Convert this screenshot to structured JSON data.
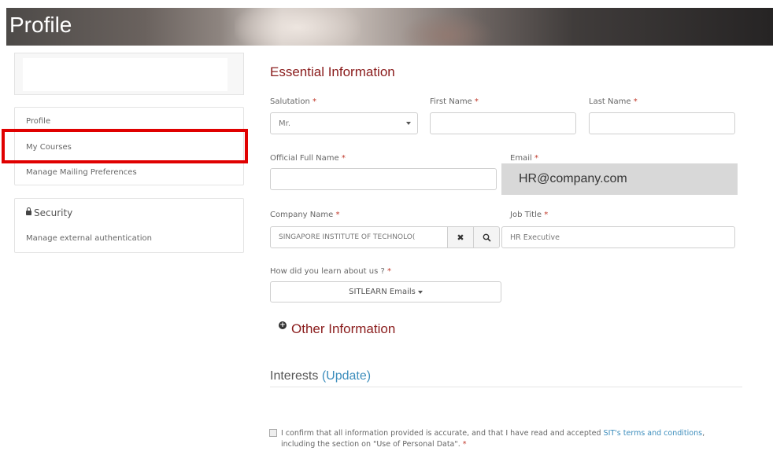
{
  "header": {
    "title": "Profile"
  },
  "sidebar": {
    "nav_items": [
      {
        "label": "Profile"
      },
      {
        "label": "My Courses"
      },
      {
        "label": "Manage Mailing Preferences"
      }
    ],
    "security": {
      "heading": "Security",
      "items": [
        {
          "label": "Manage external authentication"
        }
      ]
    }
  },
  "essential": {
    "title": "Essential Information",
    "salutation": {
      "label": "Salutation",
      "value": "Mr."
    },
    "first_name": {
      "label": "First Name",
      "value": ""
    },
    "last_name": {
      "label": "Last Name",
      "value": ""
    },
    "official_full_name": {
      "label": "Official Full Name",
      "value": ""
    },
    "email": {
      "label": "Email",
      "value": "HR@company.com"
    },
    "company_name": {
      "label": "Company Name",
      "value": "SINGAPORE INSTITUTE OF TECHNOLO("
    },
    "job_title": {
      "label": "Job Title",
      "value": "HR Executive"
    },
    "referral": {
      "label": "How did you learn about us ?",
      "value": "SITLEARN Emails"
    },
    "required_marker": "*"
  },
  "other_info": {
    "label": "Other Information"
  },
  "interests": {
    "label": "Interests",
    "update_link": "(Update)"
  },
  "confirm": {
    "text_before": "I confirm that all information provided is accurate, and that I have read and accepted ",
    "link": "SIT's terms and conditions",
    "text_after": ", including the section on \"Use of Personal Data\". ",
    "required_marker": "*"
  },
  "colors": {
    "accent": "#8a1c1c",
    "link": "#3c8dbc",
    "highlight": "#e00000"
  },
  "icons": {
    "lock": "lock-icon",
    "clear": "close-icon",
    "search": "search-icon",
    "expand": "plus-circle-icon"
  }
}
